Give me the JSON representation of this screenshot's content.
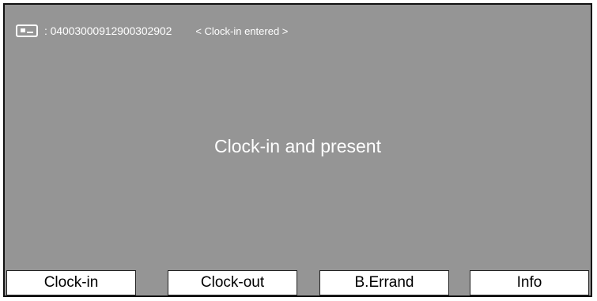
{
  "header": {
    "card_icon": "id-card-icon",
    "card_number": ": 04003000912900302902",
    "status": "< Clock-in entered >"
  },
  "main": {
    "message": "Clock-in and present"
  },
  "buttons": {
    "clock_in": "Clock-in",
    "clock_out": "Clock-out",
    "errand": "B.Errand",
    "info": "Info"
  },
  "colors": {
    "screen_background": "#959595",
    "text": "#ffffff",
    "button_background": "#ffffff"
  }
}
